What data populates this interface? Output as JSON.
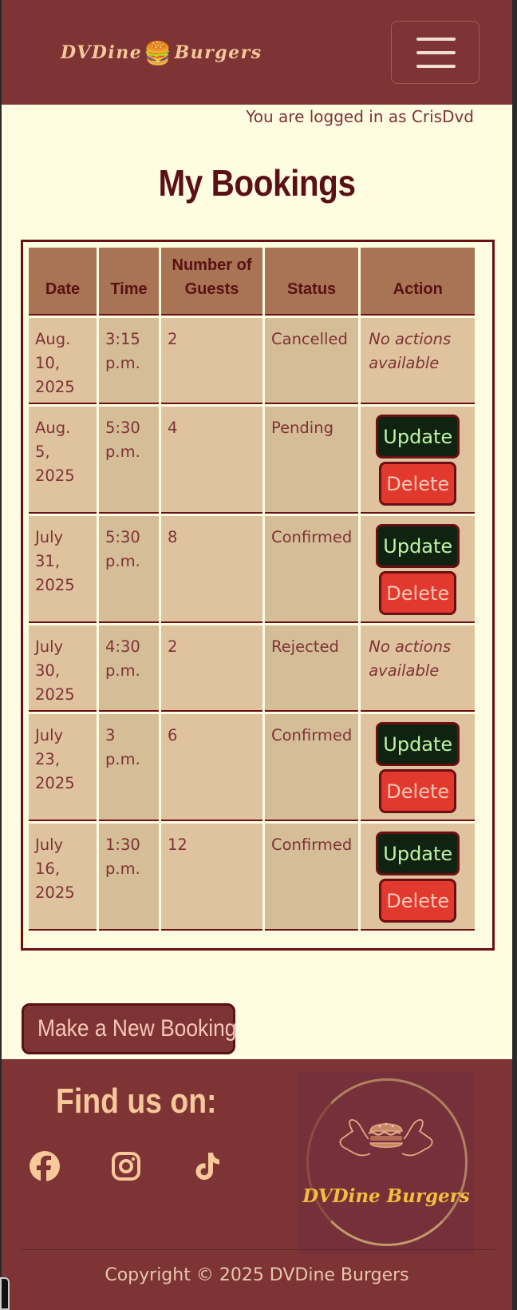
{
  "header": {
    "brand_left": "DVDine",
    "brand_icon": "🍔",
    "brand_right": "Burgers",
    "menu_icon": "hamburger-menu-icon"
  },
  "login_status": "You are logged in as CrisDvd",
  "page_title": "My Bookings",
  "table": {
    "columns": [
      "Date",
      "Time",
      "Number of Guests",
      "Status",
      "Action"
    ],
    "rows": [
      {
        "date": "Aug. 10, 2025",
        "time": "3:15 p.m.",
        "guests": "2",
        "status": "Cancelled",
        "action": "No actions available"
      },
      {
        "date": "Aug. 5, 2025",
        "time": "5:30 p.m.",
        "guests": "4",
        "status": "Pending",
        "update": "Update",
        "delete": "Delete"
      },
      {
        "date": "July 31, 2025",
        "time": "5:30 p.m.",
        "guests": "8",
        "status": "Confirmed",
        "update": "Update",
        "delete": "Delete"
      },
      {
        "date": "July 30, 2025",
        "time": "4:30 p.m.",
        "guests": "2",
        "status": "Rejected",
        "action": "No actions available"
      },
      {
        "date": "July 23, 2025",
        "time": "3 p.m.",
        "guests": "6",
        "status": "Confirmed",
        "update": "Update",
        "delete": "Delete"
      },
      {
        "date": "July 16, 2025",
        "time": "1:30 p.m.",
        "guests": "12",
        "status": "Confirmed",
        "update": "Update",
        "delete": "Delete"
      }
    ]
  },
  "new_booking_label": "Make a New Booking",
  "footer": {
    "find_us": "Find us on:",
    "social": [
      "facebook-icon",
      "instagram-icon",
      "tiktok-icon"
    ],
    "logo_text": "DVDine Burgers",
    "copyright": "Copyright © 2025 DVDine Burgers"
  },
  "colors": {
    "brand": "#7e3334",
    "background": "#fffde1",
    "header_cell": "#a87454",
    "update_button": "#0f2310",
    "delete_button": "#e2392e"
  }
}
